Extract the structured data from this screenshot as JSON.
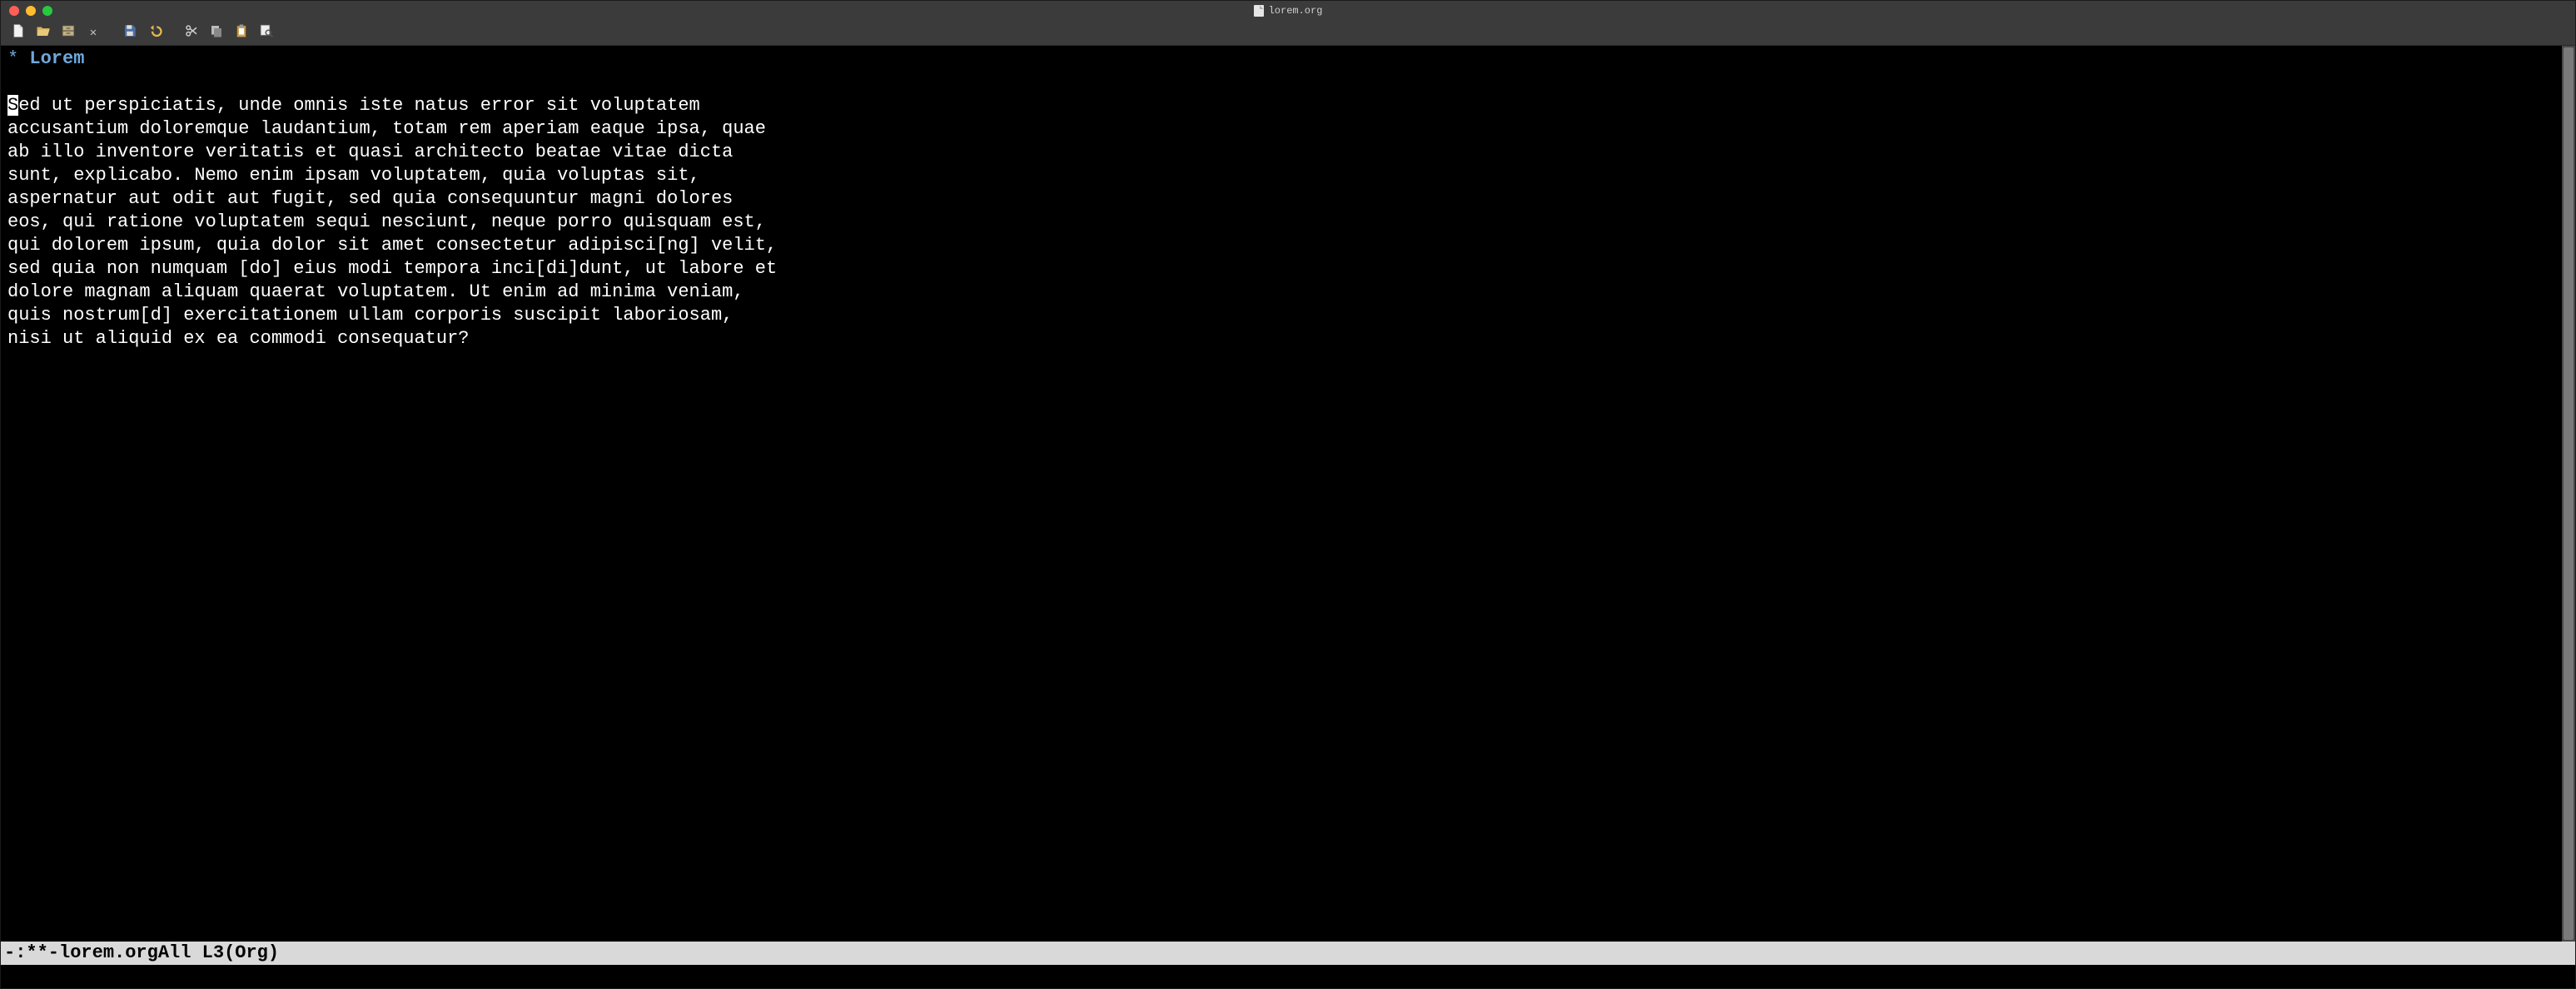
{
  "titlebar": {
    "filename": "lorem.org"
  },
  "toolbar": {
    "new": "New",
    "open": "Open",
    "dir": "Dired",
    "close": "Close",
    "save": "Save",
    "undo": "Undo",
    "cut": "Cut",
    "copy": "Copy",
    "paste": "Paste",
    "search": "Search"
  },
  "heading": {
    "star": "*",
    "text": "Lorem"
  },
  "cursor_char": "S",
  "body_after_cursor": "ed ut perspiciatis, unde omnis iste natus error sit voluptatem\naccusantium doloremque laudantium, totam rem aperiam eaque ipsa, quae\nab illo inventore veritatis et quasi architecto beatae vitae dicta\nsunt, explicabo. Nemo enim ipsam voluptatem, quia voluptas sit,\naspernatur aut odit aut fugit, sed quia consequuntur magni dolores\neos, qui ratione voluptatem sequi nesciunt, neque porro quisquam est,\nqui dolorem ipsum, quia dolor sit amet consectetur adipisci[ng] velit,\nsed quia non numquam [do] eius modi tempora inci[di]dunt, ut labore et\ndolore magnam aliquam quaerat voluptatem. Ut enim ad minima veniam,\nquis nostrum[d] exercitationem ullam corporis suscipit laboriosam,\nnisi ut aliquid ex ea commodi consequatur?",
  "modeline": {
    "left": "-:**-",
    "buffer": "lorem.org",
    "position": "All L3",
    "mode": "(Org)"
  }
}
